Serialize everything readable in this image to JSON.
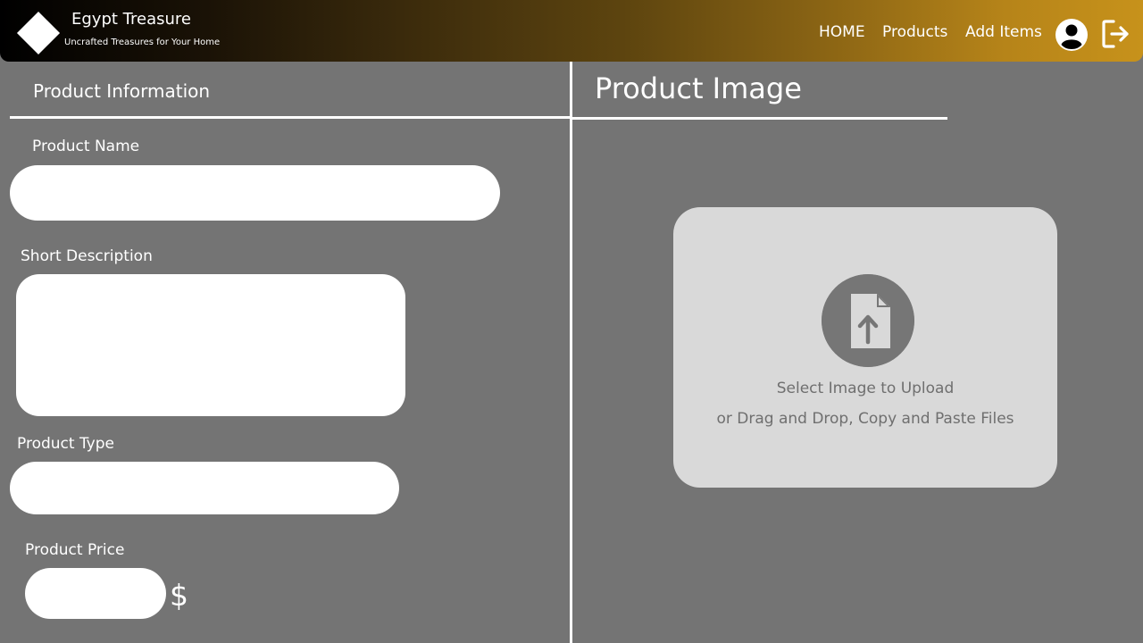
{
  "header": {
    "brand_title": "Egypt Treasure",
    "brand_subtitle": "Uncrafted Treasures for Your Home",
    "nav": {
      "home": "HOME",
      "products": "Products",
      "add_items": "Add Items"
    },
    "icons": {
      "logo": "diamond-logo-icon",
      "avatar": "user-avatar-icon",
      "logout": "logout-icon"
    }
  },
  "product_info": {
    "section_title": "Product Information",
    "name_label": "Product Name",
    "name_value": "",
    "description_label": "Short Description",
    "description_value": "",
    "type_label": "Product Type",
    "type_value": "",
    "price_label": "Product Price",
    "price_value": "",
    "currency_symbol": "$"
  },
  "product_image": {
    "section_title": "Product Image",
    "upload_line1": "Select Image to Upload",
    "upload_line2": "or Drag and Drop, Copy and Paste Files",
    "upload_icon": "file-upload-icon"
  },
  "colors": {
    "background": "#747474",
    "header_gradient_start": "#000000",
    "header_gradient_end": "#c7921b",
    "upload_box": "#d9d9d9",
    "upload_icon_bg": "#767676"
  }
}
